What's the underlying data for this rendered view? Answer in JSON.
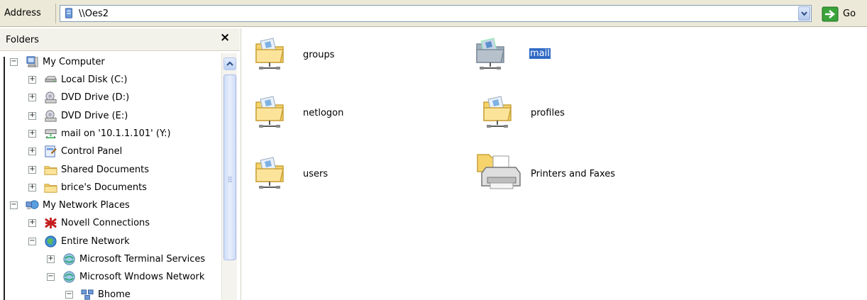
{
  "address_bar": {
    "label": "Address",
    "path": "\\\\Oes2",
    "go_label": "Go"
  },
  "folders_pane": {
    "title": "Folders",
    "close_glyph": "×",
    "tree": [
      {
        "label": "My Computer",
        "icon": "computer-icon",
        "expanded": true,
        "level": 0
      },
      {
        "label": "Local Disk (C:)",
        "icon": "hard-disk-icon",
        "expanded": false,
        "level": 1
      },
      {
        "label": "DVD Drive (D:)",
        "icon": "dvd-drive-icon",
        "expanded": false,
        "level": 1
      },
      {
        "label": "DVD Drive (E:)",
        "icon": "dvd-drive-icon",
        "expanded": false,
        "level": 1
      },
      {
        "label": "mail on '10.1.1.101' (Y:)",
        "icon": "network-drive-icon",
        "expanded": false,
        "level": 1
      },
      {
        "label": "Control Panel",
        "icon": "control-panel-icon",
        "expanded": false,
        "level": 1
      },
      {
        "label": "Shared Documents",
        "icon": "folder-icon",
        "expanded": false,
        "level": 1
      },
      {
        "label": "brice's Documents",
        "icon": "folder-icon",
        "expanded": false,
        "level": 1
      },
      {
        "label": "My Network Places",
        "icon": "network-places-icon",
        "expanded": true,
        "level": 0
      },
      {
        "label": "Novell Connections",
        "icon": "novell-icon",
        "expanded": false,
        "level": 1
      },
      {
        "label": "Entire Network",
        "icon": "globe-icon",
        "expanded": true,
        "level": 1
      },
      {
        "label": "Microsoft Terminal Services",
        "icon": "network-globe-icon",
        "expanded": false,
        "level": 2
      },
      {
        "label": "Microsoft Wndows Network",
        "icon": "network-globe-icon",
        "expanded": true,
        "level": 2
      },
      {
        "label": "Bhome",
        "icon": "workgroup-icon",
        "expanded": true,
        "level": 3
      }
    ]
  },
  "content": {
    "items": [
      {
        "label": "groups",
        "icon": "shared-folder-icon",
        "selected": false
      },
      {
        "label": "mail",
        "icon": "shared-folder-icon",
        "selected": true
      },
      {
        "label": "netlogon",
        "icon": "shared-folder-icon",
        "selected": false
      },
      {
        "label": "profiles",
        "icon": "shared-folder-icon",
        "selected": false
      },
      {
        "label": "users",
        "icon": "shared-folder-icon",
        "selected": false
      },
      {
        "label": "Printers and Faxes",
        "icon": "printers-faxes-icon",
        "selected": false
      }
    ]
  },
  "colors": {
    "selection": "#316ac5",
    "toolbar_bg": "#ece9d8",
    "folder_yellow": "#f6d36b"
  }
}
